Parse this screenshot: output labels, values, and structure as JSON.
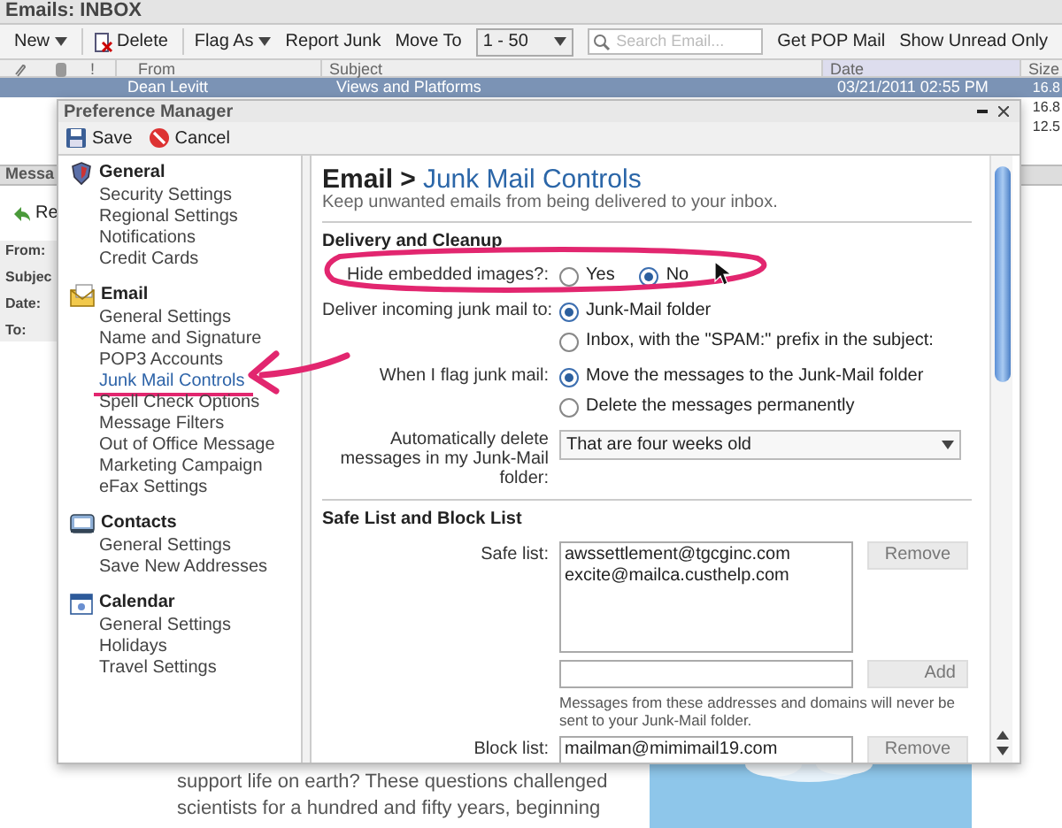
{
  "inbox": {
    "title": "Emails: INBOX",
    "toolbar": {
      "new": "New",
      "delete": "Delete",
      "flag": "Flag As",
      "report": "Report Junk",
      "move": "Move To",
      "range": "1 - 50",
      "search": {
        "placeholder": "Search Email..."
      },
      "pop": "Get POP Mail",
      "unread": "Show Unread Only"
    },
    "columns": {
      "flag": "!",
      "from": "From",
      "subject": "Subject",
      "date": "Date",
      "size": "Size"
    },
    "rows": [
      {
        "from": "Dean Levitt",
        "subject": "Views and Platforms",
        "date": "03/21/2011 02:55 PM",
        "size": "16.8",
        "selected": true
      },
      {
        "size": "16.8",
        "selected": false
      },
      {
        "size": "12.5",
        "selected": false
      }
    ],
    "message": {
      "header": "Messa",
      "reply": "Re",
      "fields": [
        "From:",
        "Subjec",
        "Date:",
        "To:"
      ],
      "body": [
        "support life on earth? These questions challenged",
        "scientists for a hundred and fifty years, beginning"
      ],
      "image": {
        "kind": "picture"
      }
    }
  },
  "dialog": {
    "title": "Preference Manager",
    "save": "Save",
    "cancel": "Cancel",
    "sidebar": [
      {
        "kind": "general",
        "label": "General",
        "items": [
          {
            "label": "Security Settings",
            "selected": false
          },
          {
            "label": "Regional Settings",
            "selected": false
          },
          {
            "label": "Notifications",
            "selected": false
          },
          {
            "label": "Credit Cards",
            "selected": false
          }
        ]
      },
      {
        "kind": "email",
        "label": "Email",
        "items": [
          {
            "label": "General Settings",
            "selected": false
          },
          {
            "label": "Name and Signature",
            "selected": false
          },
          {
            "label": "POP3 Accounts",
            "selected": false
          },
          {
            "label": "Junk Mail Controls",
            "selected": true
          },
          {
            "label": "Spell Check Options",
            "selected": false
          },
          {
            "label": "Message Filters",
            "selected": false
          },
          {
            "label": "Out of Office Message",
            "selected": false
          },
          {
            "label": "Marketing Campaign",
            "selected": false
          },
          {
            "label": "eFax Settings",
            "selected": false
          }
        ]
      },
      {
        "kind": "contacts",
        "label": "Contacts",
        "items": [
          {
            "label": "General Settings",
            "selected": false
          },
          {
            "label": "Save New Addresses",
            "selected": false
          }
        ]
      },
      {
        "kind": "calendar",
        "label": "Calendar",
        "items": [
          {
            "label": "General Settings",
            "selected": false
          },
          {
            "label": "Holidays",
            "selected": false
          },
          {
            "label": "Travel Settings",
            "selected": false
          }
        ]
      }
    ],
    "content": {
      "crumb": "Email >",
      "title": "Junk Mail Controls",
      "subtitle": "Keep unwanted emails from being delivered to your inbox.",
      "delivery": {
        "heading": "Delivery and Cleanup",
        "hide": {
          "label": "Hide embedded images?:",
          "options": [
            {
              "label": "Yes",
              "selected": false
            },
            {
              "label": "No",
              "selected": true
            }
          ]
        },
        "deliver": {
          "label": "Deliver incoming junk mail to:",
          "options": [
            {
              "label": "Junk-Mail folder",
              "selected": true
            },
            {
              "label": "Inbox, with the \"SPAM:\" prefix in the subject:",
              "selected": false
            }
          ]
        },
        "flag": {
          "label": "When I flag junk mail:",
          "options": [
            {
              "label": "Move the messages to the Junk-Mail folder",
              "selected": true
            },
            {
              "label": "Delete the messages permanently",
              "selected": false
            }
          ]
        },
        "auto": {
          "label": "Automatically delete messages in my Junk-Mail folder:",
          "value": "That are four weeks old"
        }
      },
      "lists": {
        "heading": "Safe List and Block List",
        "safe_label": "Safe list:",
        "safe": [
          "awssettlement@tgcginc.com",
          "excite@mailca.custhelp.com"
        ],
        "remove": "Remove",
        "add": "Add",
        "note": "Messages from these addresses and domains will never be sent to your Junk-Mail folder.",
        "block_label": "Block list:",
        "block": [
          "mailman@mimimail19.com"
        ],
        "remove2": "Remove"
      }
    }
  }
}
